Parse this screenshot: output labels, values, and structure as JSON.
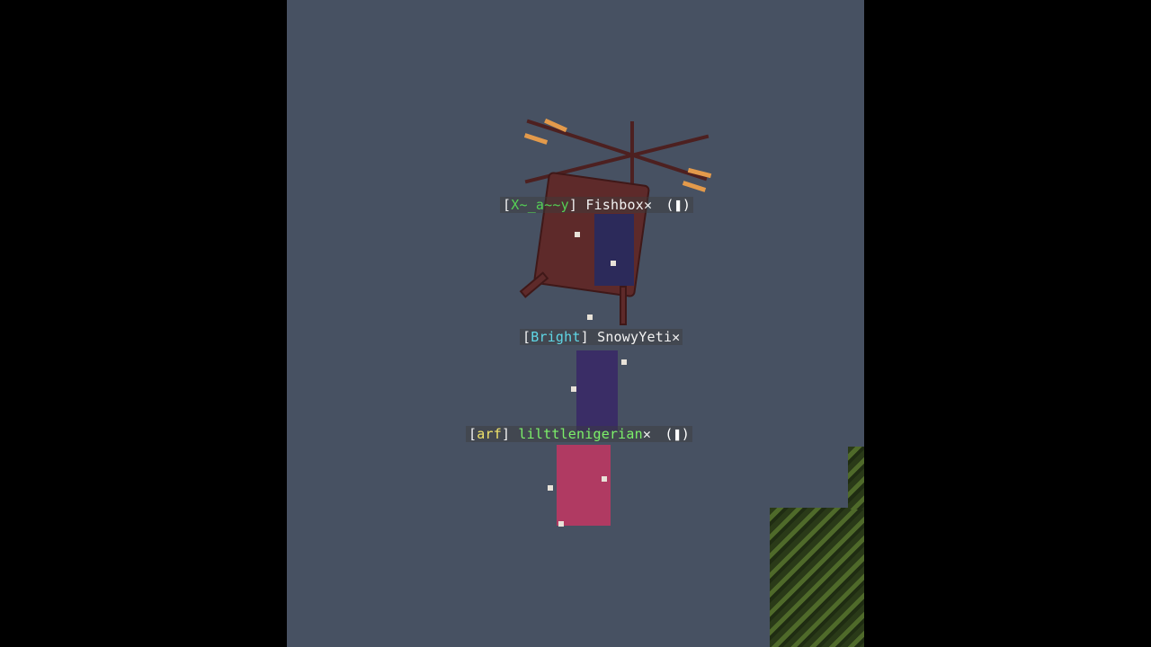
{
  "players": [
    {
      "bracket_open": "[",
      "rank": "X~_a~~y",
      "bracket_close": "]",
      "name": "Fishbox",
      "mark": "✕",
      "hp": "(❚)"
    },
    {
      "bracket_open": "[",
      "rank": "Bright",
      "bracket_close": "]",
      "name": "SnowyYeti",
      "mark": "✕",
      "hp": ""
    },
    {
      "bracket_open": "[",
      "rank": "arf",
      "bracket_close": "]",
      "name": "lilttlenigerian",
      "mark": "✕",
      "hp": "(❚)"
    }
  ],
  "colors": {
    "sky": "#475162",
    "helicopter": "#5e2a2a",
    "rotor_tips": "#e39a4b",
    "rank_green": "#55d155",
    "rank_aqua": "#5fd7e6",
    "rank_yellow": "#f0e36a",
    "name_lime": "#7cf06a",
    "leaves": "#3c5220"
  }
}
